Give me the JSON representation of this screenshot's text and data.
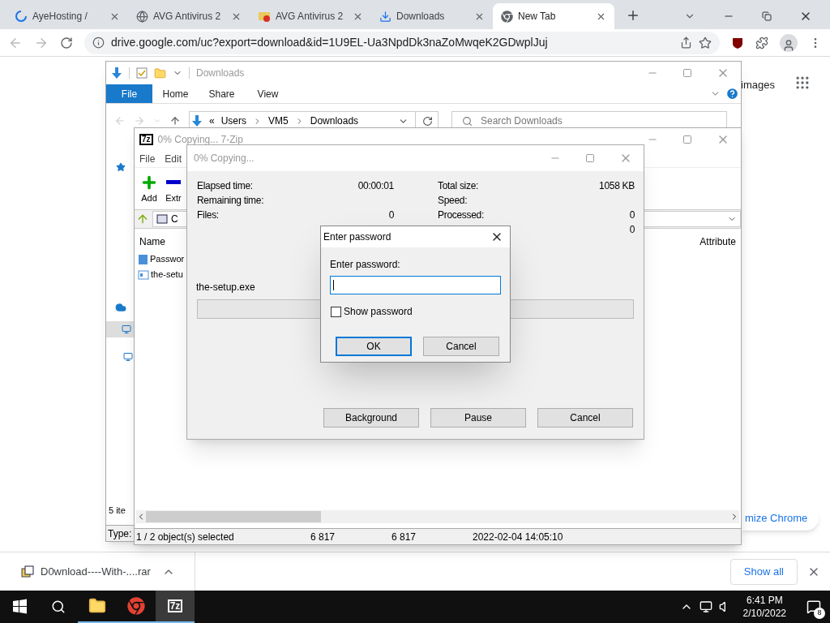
{
  "browser": {
    "tabs": [
      {
        "title": "AyeHosting /",
        "kind": "spinner",
        "selected": false
      },
      {
        "title": "AVG Antivirus 2",
        "kind": "globe",
        "selected": false
      },
      {
        "title": "AVG Antivirus 2",
        "kind": "avg",
        "selected": false
      },
      {
        "title": "Downloads",
        "kind": "download",
        "selected": false
      },
      {
        "title": "New Tab",
        "kind": "chrome",
        "selected": true
      }
    ],
    "url": "drive.google.com/uc?export=download&id=1U9EL-Ua3NpdDk3naZoMwqeK2GDwplJuj",
    "page": {
      "images_link": "images",
      "customize": "mize Chrome"
    },
    "download_shelf": {
      "file": "D0wnload----With-....rar",
      "show_all": "Show all"
    }
  },
  "explorer": {
    "title": "Downloads",
    "ribbon_tabs": [
      {
        "label": "File",
        "selected": true
      },
      {
        "label": "Home",
        "selected": false
      },
      {
        "label": "Share",
        "selected": false
      },
      {
        "label": "View",
        "selected": false
      }
    ],
    "overflow": "«",
    "breadcrumb": [
      "Users",
      "VM5",
      "Downloads"
    ],
    "search_placeholder": "Search Downloads",
    "item_count": "5 ite",
    "details_label": "Type:"
  },
  "sevenzip": {
    "icon_text": "7z",
    "title": "0% Copying... 7-Zip",
    "menu": [
      "File",
      "Edit"
    ],
    "toolbar": [
      {
        "label": "Add",
        "kind": "add"
      },
      {
        "label": "Extr",
        "kind": "extract"
      }
    ],
    "path": "C",
    "columns": [
      "Name",
      "Attribute"
    ],
    "rows": [
      {
        "name": "Passwor",
        "kind": "text"
      },
      {
        "name": "the-setu",
        "kind": "exe"
      }
    ],
    "status": [
      "1 / 2 object(s) selected",
      "6 817",
      "6 817",
      "2022-02-04 14:05:10"
    ]
  },
  "progress": {
    "title": "0% Copying...",
    "stats_left": [
      {
        "label": "Elapsed time:",
        "value": "00:00:01"
      },
      {
        "label": "Remaining time:"
      },
      {
        "label": "Files:",
        "value": "0"
      }
    ],
    "stats_right": [
      {
        "label": "Total size:",
        "value": "1058 KB"
      },
      {
        "label": "Speed:"
      },
      {
        "label": "Processed:",
        "value": "0"
      },
      {
        "value": "0"
      }
    ],
    "file": "the-setup.exe",
    "level": 0,
    "buttons": [
      "Background",
      "Pause",
      "Cancel"
    ]
  },
  "password_dialog": {
    "title": "Enter password",
    "label": "Enter password:",
    "show_password": {
      "label": "Show password",
      "checked": false
    },
    "buttons": [
      {
        "label": "OK",
        "default": true
      },
      {
        "label": "Cancel",
        "default": false
      }
    ]
  },
  "taskbar": {
    "apps": [
      {
        "kind": "explorer",
        "active": false
      },
      {
        "kind": "chrome",
        "active": false
      },
      {
        "kind": "sevenzip",
        "label": "7z",
        "active": true
      }
    ],
    "time": "6:41 PM",
    "date": "2/10/2022",
    "notifications": "8"
  }
}
